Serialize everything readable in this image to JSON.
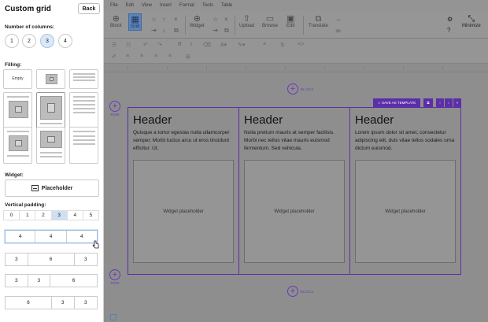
{
  "sidebar": {
    "title": "Custom grid",
    "back_label": "Back",
    "columns_label": "Number of columns:",
    "columns": [
      "1",
      "2",
      "3",
      "4"
    ],
    "columns_selected": "3",
    "filling_label": "Filling:",
    "filling_empty_label": "Empty",
    "widget_label": "Widget:",
    "widget_button": "Placeholder",
    "padding_label": "Vertical padding:",
    "padding_options": [
      "0",
      "1",
      "2",
      "3",
      "4",
      "5"
    ],
    "padding_selected": "3",
    "layouts": [
      [
        "4",
        "4",
        "4"
      ],
      [
        "3",
        "6",
        "3"
      ],
      [
        "3",
        "3",
        "6"
      ],
      [
        "6",
        "3",
        "3"
      ]
    ]
  },
  "menu": [
    "File",
    "Edit",
    "View",
    "Insert",
    "Format",
    "Tools",
    "Table"
  ],
  "ribbon": {
    "block": "Block",
    "grid": "Grid",
    "widget": "Widget",
    "upload": "Upload",
    "browse": "Browse",
    "edit": "Edit",
    "translate": "Translate",
    "minimize": "Minimize"
  },
  "canvas": {
    "add_block_label": "BLOCK",
    "row_label": "ROW",
    "save_template": "SAVE AS TEMPLATE",
    "columns": [
      {
        "header": "Header",
        "text": "Quisque a tortor egestas nulla ullamcorper semper. Morbi luctus arcu ut eros tincidunt efficitur. Ut.",
        "placeholder": "Widget placeholder"
      },
      {
        "header": "Header",
        "text": "Nulla pretium mauris at semper facilisis. Morbi nec tellus vitae mauris euismod fermentum. Sed vehicula.",
        "placeholder": "Widget placeholder"
      },
      {
        "header": "Header",
        "text": "Lorem ipsum dolor sit amet, consectetur adipiscing elit, duis vitae tellus sodales urna dictum euismod.",
        "placeholder": "Widget placeholder"
      }
    ]
  },
  "colors": {
    "accent": "#5b2fa8",
    "selected": "#dbe8f8"
  }
}
